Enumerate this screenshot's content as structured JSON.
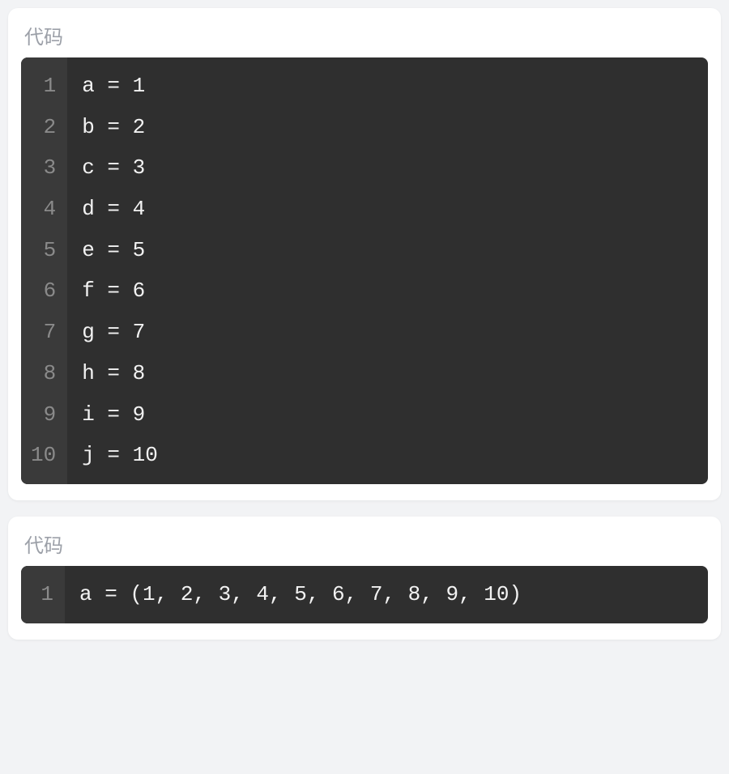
{
  "blocks": [
    {
      "title": "代码",
      "lines": [
        "a = 1",
        "b = 2",
        "c = 3",
        "d = 4",
        "e = 5",
        "f = 6",
        "g = 7",
        "h = 8",
        "i = 9",
        "j = 10"
      ]
    },
    {
      "title": "代码",
      "lines": [
        "a = (1, 2, 3, 4, 5, 6, 7, 8, 9, 10)"
      ]
    }
  ]
}
